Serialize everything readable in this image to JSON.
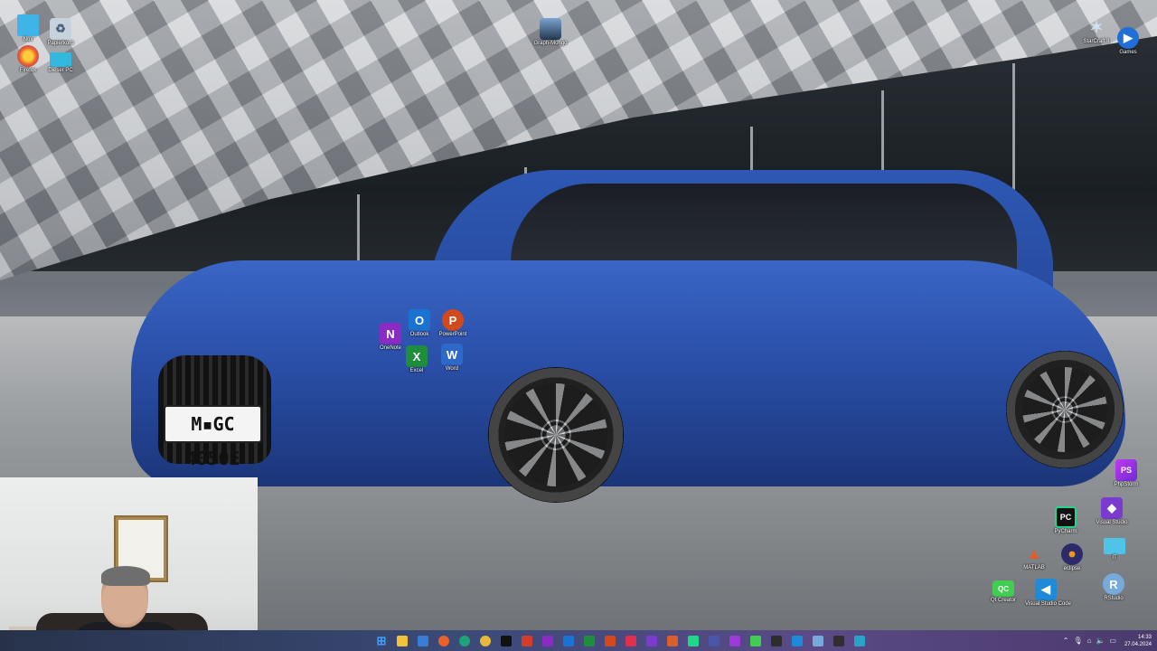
{
  "desktop": {
    "icons_topleft": [
      {
        "name": "nox-icon",
        "label": "Nox",
        "color": "#3fb4e8",
        "glyph": ""
      },
      {
        "name": "recycle-bin-icon",
        "label": "Papierkorb",
        "color": "#8fa5b8",
        "glyph": "♻"
      },
      {
        "name": "firefox-icon",
        "label": "Firefox",
        "color": "#e8622a",
        "glyph": "●"
      },
      {
        "name": "this-pc-icon",
        "label": "Dieser PC",
        "color": "#35b8e0",
        "glyph": ""
      }
    ],
    "icon_shortcut_mid": {
      "name": "shortcut-file-icon",
      "label": "Graph-Mongo",
      "color": "#3b5f8a"
    },
    "icons_topright": [
      {
        "name": "starcraft-icon",
        "label": "StarCraft II",
        "color": "#6c8fb8",
        "glyph": "✶"
      },
      {
        "name": "games-icon",
        "label": "Games",
        "color": "#1f6fd6",
        "glyph": "▶"
      }
    ],
    "office_icons": [
      {
        "name": "onenote-icon",
        "label": "OneNote",
        "color": "#8a2cc4",
        "glyph": "N"
      },
      {
        "name": "outlook-icon",
        "label": "Outlook",
        "color": "#1a73d1",
        "glyph": "O"
      },
      {
        "name": "powerpoint-icon",
        "label": "PowerPoint",
        "color": "#d04a1e",
        "glyph": "P"
      },
      {
        "name": "excel-icon",
        "label": "Excel",
        "color": "#1e8e3e",
        "glyph": "X"
      },
      {
        "name": "word-icon",
        "label": "Word",
        "color": "#2e68c9",
        "glyph": "W"
      }
    ],
    "dev_icons": [
      {
        "name": "phpstorm-icon",
        "label": "PhpStorm",
        "color": "#9b3ad6",
        "glyph": "PS"
      },
      {
        "name": "pycharm-icon",
        "label": "PyCharm",
        "color": "#1a1a1a",
        "glyph": "PC"
      },
      {
        "name": "visual-studio-icon",
        "label": "Visual Studio",
        "color": "#7a3bcf",
        "glyph": "◆"
      },
      {
        "name": "matlab-icon",
        "label": "MATLAB",
        "color": "#d9602a",
        "glyph": "▲"
      },
      {
        "name": "eclipse-icon",
        "label": "eclipse",
        "color": "#2c2a6b",
        "glyph": "◉"
      },
      {
        "name": "it-folder-icon",
        "label": "IT",
        "color": "#4fc3e8",
        "glyph": ""
      },
      {
        "name": "qt-creator-icon",
        "label": "Qt Creator",
        "color": "#41cd52",
        "glyph": "QC"
      },
      {
        "name": "vscode-icon",
        "label": "Visual Studio Code",
        "color": "#1f8ad8",
        "glyph": "◀"
      },
      {
        "name": "rstudio-icon",
        "label": "RStudio",
        "color": "#75aadb",
        "glyph": "R"
      }
    ],
    "license_plate": "M▪GC 4050E"
  },
  "taskbar": {
    "apps": [
      {
        "name": "start-icon",
        "color": "#3da0ff",
        "glyph": "⊞"
      },
      {
        "name": "file-explorer-icon",
        "color": "#f3c23c",
        "glyph": ""
      },
      {
        "name": "store-icon",
        "color": "#3a7bd5",
        "glyph": ""
      },
      {
        "name": "firefox-taskbar-icon",
        "color": "#e8622a",
        "glyph": ""
      },
      {
        "name": "edge-icon",
        "color": "#1fa37a",
        "glyph": ""
      },
      {
        "name": "chrome-icon",
        "color": "#e8b83a",
        "glyph": ""
      },
      {
        "name": "tiktok-icon",
        "color": "#111111",
        "glyph": ""
      },
      {
        "name": "acrobat-icon",
        "color": "#d43b2a",
        "glyph": ""
      },
      {
        "name": "onenote-taskbar-icon",
        "color": "#8a2cc4",
        "glyph": ""
      },
      {
        "name": "outlook-taskbar-icon",
        "color": "#1a73d1",
        "glyph": ""
      },
      {
        "name": "excel-taskbar-icon",
        "color": "#1e8e3e",
        "glyph": ""
      },
      {
        "name": "powerpoint-taskbar-icon",
        "color": "#d04a1e",
        "glyph": ""
      },
      {
        "name": "music-icon",
        "color": "#e0304e",
        "glyph": ""
      },
      {
        "name": "visual-studio-taskbar-icon",
        "color": "#7a3bcf",
        "glyph": ""
      },
      {
        "name": "matlab-taskbar-icon",
        "color": "#d9602a",
        "glyph": ""
      },
      {
        "name": "pycharm-taskbar-icon",
        "color": "#21d789",
        "glyph": ""
      },
      {
        "name": "eclipse-taskbar-icon",
        "color": "#4a57a8",
        "glyph": ""
      },
      {
        "name": "phpstorm-taskbar-icon",
        "color": "#9b3ad6",
        "glyph": ""
      },
      {
        "name": "qt-taskbar-icon",
        "color": "#41cd52",
        "glyph": ""
      },
      {
        "name": "terminal-icon",
        "color": "#2d2d2d",
        "glyph": ""
      },
      {
        "name": "vscode-taskbar-icon",
        "color": "#1f8ad8",
        "glyph": ""
      },
      {
        "name": "rstudio-taskbar-icon",
        "color": "#75aadb",
        "glyph": ""
      },
      {
        "name": "obs-icon",
        "color": "#302e31",
        "glyph": ""
      },
      {
        "name": "browser-taskbar-icon",
        "color": "#2aa3c9",
        "glyph": ""
      }
    ],
    "clock_time": "14:33",
    "clock_date": "27.04.2024"
  }
}
